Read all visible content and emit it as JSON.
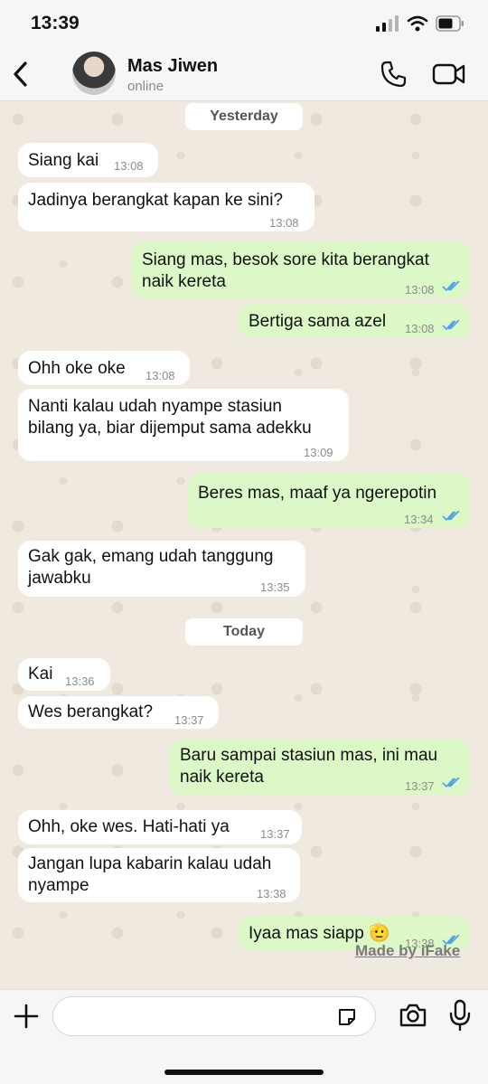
{
  "status": {
    "time": "13:39"
  },
  "header": {
    "name": "Mas Jiwen",
    "status": "online"
  },
  "dates": {
    "yesterday": "Yesterday",
    "today": "Today"
  },
  "messages": [
    {
      "dir": "in",
      "text": "Siang kai",
      "time": "13:08"
    },
    {
      "dir": "in",
      "text": "Jadinya berangkat kapan ke sini?",
      "time": "13:08"
    },
    {
      "dir": "out",
      "text": "Siang mas, besok sore kita berangkat\nnaik kereta",
      "time": "13:08"
    },
    {
      "dir": "out",
      "text": "Bertiga sama azel",
      "time": "13:08"
    },
    {
      "dir": "in",
      "text": "Ohh oke oke",
      "time": "13:08"
    },
    {
      "dir": "in",
      "text": "Nanti kalau udah nyampe stasiun\nbilang ya, biar dijemput sama adekku",
      "time": "13:09"
    },
    {
      "dir": "out",
      "text": "Beres mas, maaf ya ngerepotin",
      "time": "13:34"
    },
    {
      "dir": "in",
      "text": "Gak gak, emang udah tanggung\njawabku",
      "time": "13:35"
    },
    {
      "dir": "in",
      "text": "Kai",
      "time": "13:36"
    },
    {
      "dir": "in",
      "text": "Wes berangkat?",
      "time": "13:37"
    },
    {
      "dir": "out",
      "text": "Baru sampai stasiun mas, ini mau\nnaik kereta",
      "time": "13:37"
    },
    {
      "dir": "in",
      "text": "Ohh, oke wes. Hati-hati ya",
      "time": "13:37"
    },
    {
      "dir": "in",
      "text": "Jangan lupa kabarin kalau udah\nnyampe",
      "time": "13:38"
    },
    {
      "dir": "out",
      "text": "Iyaa mas siapp 🫡",
      "time": "13:38"
    }
  ],
  "watermark": "Made by iFake",
  "input": {
    "placeholder": ""
  },
  "colors": {
    "incoming": "#ffffff",
    "outgoing": "#dbf8c6",
    "read_ticks": "#4fa3e3",
    "chat_bg": "#efe9df"
  }
}
